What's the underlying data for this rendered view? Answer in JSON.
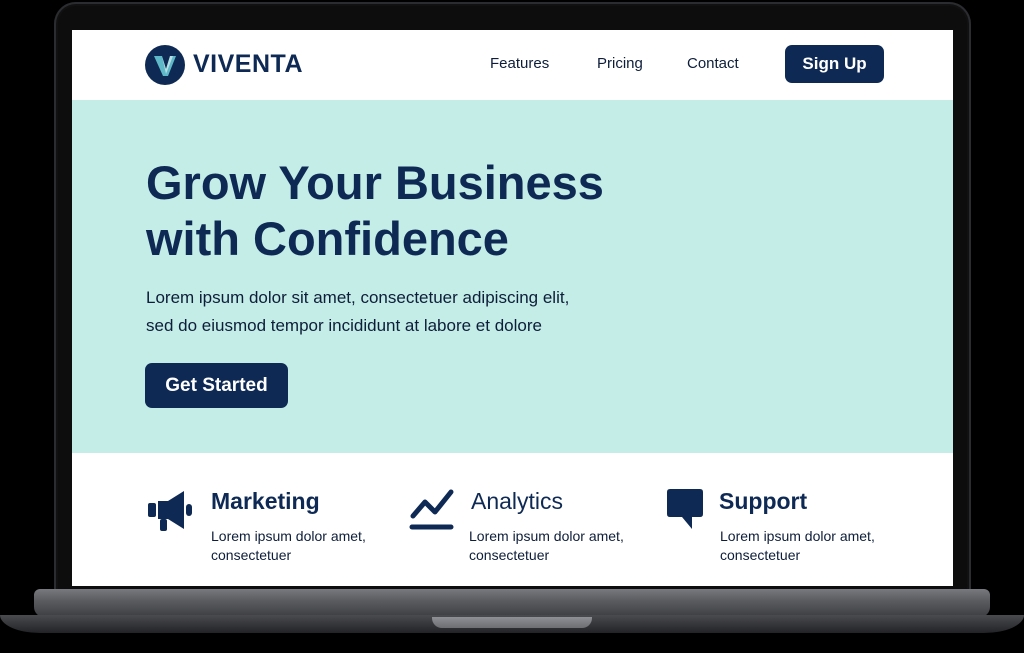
{
  "brand": {
    "name": "VIVENTA",
    "logo_letter": "V",
    "color": "#0e2a54"
  },
  "nav": {
    "links": [
      "Features",
      "Pricing",
      "Contact"
    ],
    "signup_label": "Sign Up"
  },
  "hero": {
    "title": "Grow Your Business with Confidence",
    "subtitle_line1": "Lorem ipsum dolor sit amet, consectetuer adipiscing elit,",
    "subtitle_line2": "sed do eiusmod tempor incididunt at labore et dolore",
    "cta_label": "Get Started",
    "background": "#c3ede6"
  },
  "features": [
    {
      "title": "Marketing",
      "desc": "Lorem ipsum dolor amet, consectetuer",
      "icon": "megaphone-icon"
    },
    {
      "title": "Analytics",
      "desc": "Lorem ipsum dolor amet, consectetuer",
      "icon": "chart-line-icon"
    },
    {
      "title": "Support",
      "desc": "Lorem ipsum dolor amet, consectetuer",
      "icon": "chat-bubble-icon"
    }
  ]
}
